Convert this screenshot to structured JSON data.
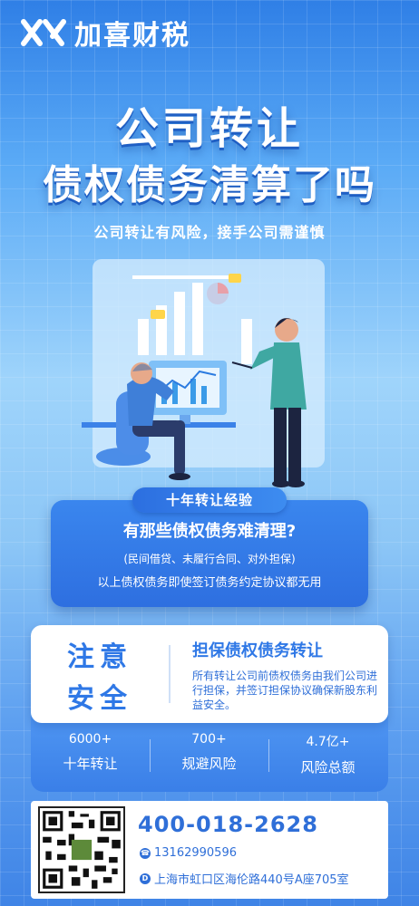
{
  "brand": {
    "name": "加喜财税",
    "logo_icon": "xj-monogram-icon"
  },
  "hero": {
    "title_line1": "公司转让",
    "title_line2": "债权债务清算了吗",
    "subtitle": "公司转让有风险，接手公司需谨慎"
  },
  "badge": {
    "label": "十年转让经验"
  },
  "question_card": {
    "title": "有那些债权债务难清理?",
    "examples": "(民间借贷、未履行合同、对外担保)",
    "note": "以上债权债务即使签订债务约定协议都无用"
  },
  "notice_card": {
    "big_line1": "注意",
    "big_line2": "安全",
    "title": "担保债权债务转让",
    "body": "所有转让公司前债权债务由我们公司进行担保，并签订担保协议确保新股东利益安全。"
  },
  "stats": [
    {
      "value": "6000+",
      "label": "十年转让"
    },
    {
      "value": "700+",
      "label": "规避风险"
    },
    {
      "value": "4.7亿+",
      "label": "风险总额"
    }
  ],
  "contact": {
    "hotline": "400-018-2628",
    "mobile": "13162990596",
    "address": "上海市虹口区海伦路440号A座705室",
    "mobile_icon": "phone-icon",
    "address_icon": "location-icon"
  },
  "colors": {
    "primary": "#2f78e6",
    "dark": "#2f6fd8",
    "bg_top": "#2f7fe6",
    "bg_mid": "#9fd4fb"
  }
}
